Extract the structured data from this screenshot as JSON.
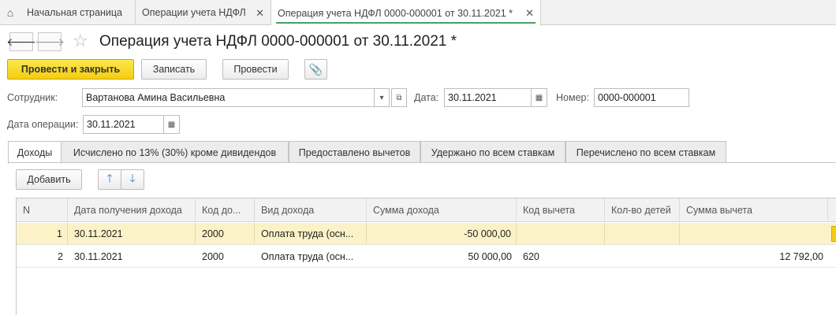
{
  "top_tabs": [
    {
      "label": "Начальная страница"
    },
    {
      "label": "Операции учета НДФЛ"
    },
    {
      "label": "Операция учета НДФЛ 0000-000001 от 30.11.2021 *"
    }
  ],
  "header": {
    "title": "Операция учета НДФЛ 0000-000001 от 30.11.2021 *"
  },
  "toolbar": {
    "post_close_label": "Провести и закрыть",
    "save_label": "Записать",
    "post_label": "Провести"
  },
  "form": {
    "employee_label": "Сотрудник:",
    "employee_value": "Вартанова Амина Васильевна",
    "date_label": "Дата:",
    "date_value": "30.11.2021",
    "number_label": "Номер:",
    "number_value": "0000-000001",
    "op_date_label": "Дата операции:",
    "op_date_value": "30.11.2021"
  },
  "tabs": [
    {
      "label": "Доходы"
    },
    {
      "label": "Исчислено по 13% (30%) кроме дивидендов"
    },
    {
      "label": "Предоставлено вычетов"
    },
    {
      "label": "Удержано по всем ставкам"
    },
    {
      "label": "Перечислено по всем ставкам"
    }
  ],
  "grid_toolbar": {
    "add_label": "Добавить"
  },
  "grid": {
    "columns": [
      "N",
      "Дата получения дохода",
      "Код до...",
      "Вид дохода",
      "Сумма дохода",
      "Код вычета",
      "Кол-во детей",
      "Сумма вычета"
    ],
    "rows": [
      {
        "n": "1",
        "date": "30.11.2021",
        "code": "2000",
        "kind": "Оплата труда (осн...",
        "amount": "-50 000,00",
        "ded_code": "",
        "children": "",
        "ded_amount": ""
      },
      {
        "n": "2",
        "date": "30.11.2021",
        "code": "2000",
        "kind": "Оплата труда (осн...",
        "amount": "50 000,00",
        "ded_code": "620",
        "children": "",
        "ded_amount": "12 792,00"
      }
    ]
  },
  "colors": {
    "accent_yellow": "#f4cd10",
    "active_tab_underline": "#47a164",
    "selected_row": "#fbf2c7"
  }
}
